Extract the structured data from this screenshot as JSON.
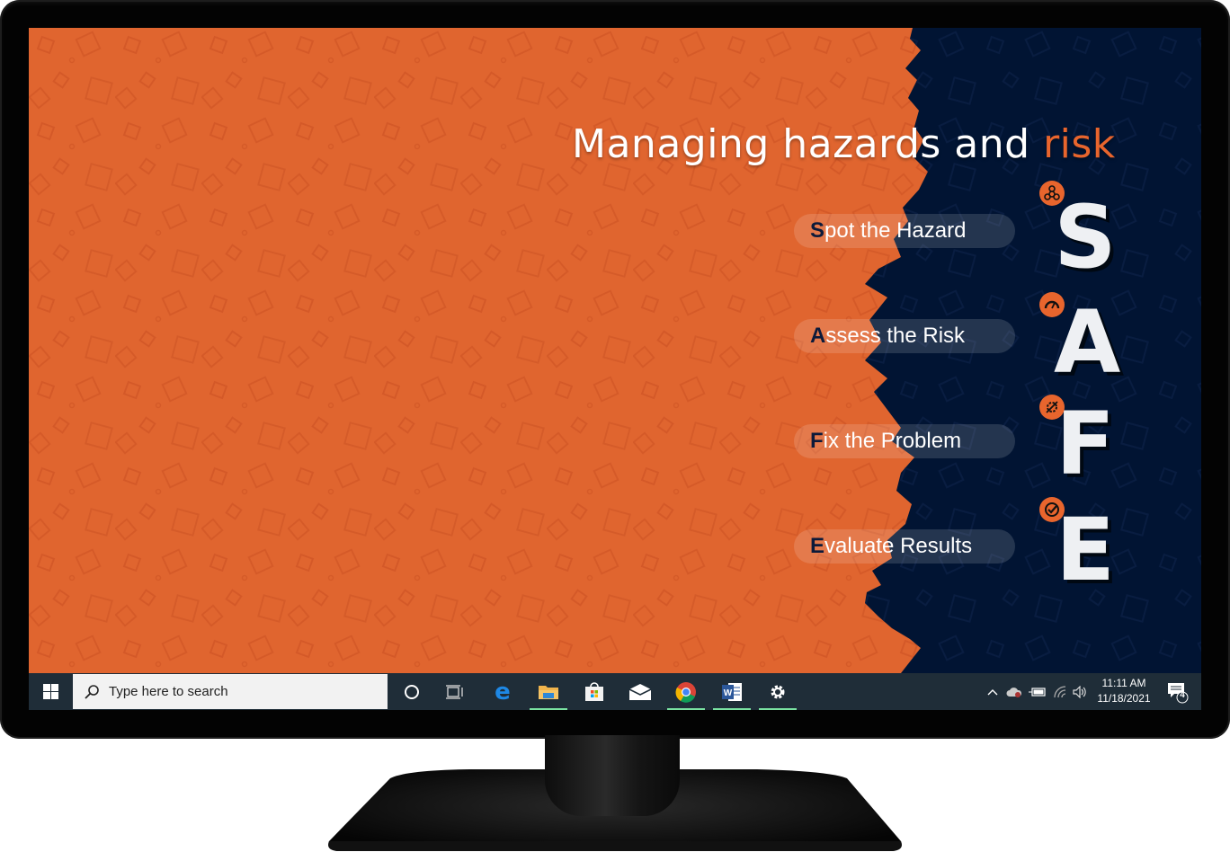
{
  "wallpaper": {
    "title_main": "Managing hazards and ",
    "title_accent": "risk",
    "colors": {
      "orange": "#e0652f",
      "navy": "#011433",
      "accent": "#e8652d",
      "letter": "#eef0f3"
    },
    "steps": [
      {
        "lead": "S",
        "rest": "pot the Hazard",
        "letter": "S",
        "icon": "biohazard-icon"
      },
      {
        "lead": "A",
        "rest": "ssess the Risk",
        "letter": "A",
        "icon": "gauge-icon"
      },
      {
        "lead": "F",
        "rest": "ix the Problem",
        "letter": "F",
        "icon": "gear-wrench-icon"
      },
      {
        "lead": "E",
        "rest": "valuate Results",
        "letter": "E",
        "icon": "check-circle-icon"
      }
    ]
  },
  "taskbar": {
    "search_placeholder": "Type here to search",
    "apps": [
      "Cortana",
      "Task View",
      "Microsoft Edge",
      "File Explorer",
      "Microsoft Store",
      "Mail",
      "Google Chrome",
      "Microsoft Word",
      "Settings"
    ],
    "clock_time": "11:11 AM",
    "clock_date": "11/18/2021",
    "notification_count": "4"
  }
}
